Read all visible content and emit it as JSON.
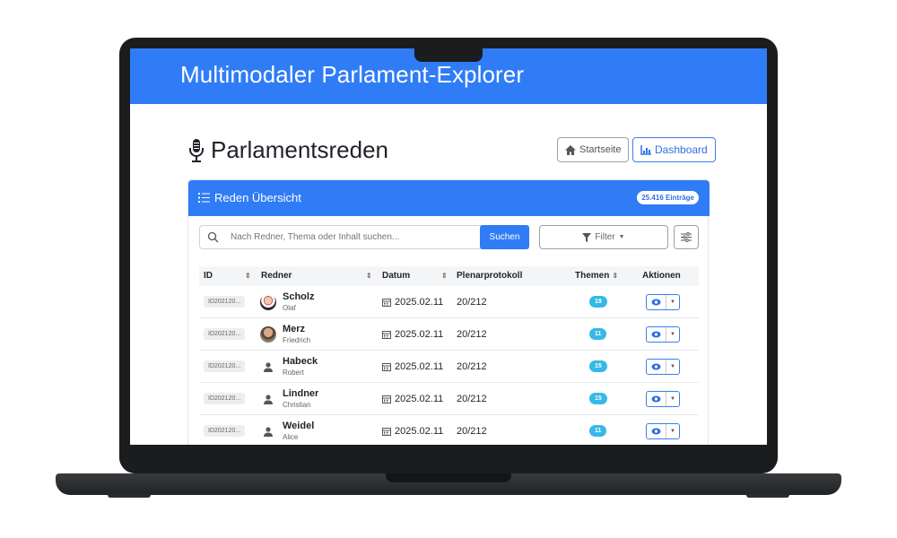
{
  "app": {
    "title": "Multimodaler Parlament-Explorer"
  },
  "page": {
    "title": "Parlamentsreden"
  },
  "nav": {
    "home_label": "Startseite",
    "dashboard_label": "Dashboard"
  },
  "card": {
    "title": "Reden Übersicht",
    "count": "25.416 Einträge"
  },
  "search": {
    "placeholder": "Nach Redner, Thema oder Inhalt suchen...",
    "button_label": "Suchen"
  },
  "filter": {
    "label": "Filter"
  },
  "table": {
    "headers": {
      "id": "ID",
      "speaker": "Redner",
      "date": "Datum",
      "protocol": "Plenarprotokoll",
      "topics": "Themen",
      "actions": "Aktionen"
    },
    "rows": [
      {
        "id": "ID202120...",
        "last": "Scholz",
        "first": "Olaf",
        "date": "2025.02.11",
        "protocol": "20/212",
        "topics": "19",
        "avatar": "photo-1"
      },
      {
        "id": "ID202120...",
        "last": "Merz",
        "first": "Friedrich",
        "date": "2025.02.11",
        "protocol": "20/212",
        "topics": "11",
        "avatar": "photo-2"
      },
      {
        "id": "ID202120...",
        "last": "Habeck",
        "first": "Robert",
        "date": "2025.02.11",
        "protocol": "20/212",
        "topics": "15",
        "avatar": "generic"
      },
      {
        "id": "ID202120...",
        "last": "Lindner",
        "first": "Christian",
        "date": "2025.02.11",
        "protocol": "20/212",
        "topics": "15",
        "avatar": "generic"
      },
      {
        "id": "ID202120...",
        "last": "Weidel",
        "first": "Alice",
        "date": "2025.02.11",
        "protocol": "20/212",
        "topics": "11",
        "avatar": "generic"
      }
    ]
  },
  "colors": {
    "primary": "#2f7cf6",
    "info": "#36b9e6"
  },
  "icons": {
    "mic": "microphone-icon",
    "home": "home-icon",
    "dashboard": "chart-icon",
    "list": "list-icon",
    "search": "search-icon",
    "filter": "filter-icon",
    "settings": "sliders-icon",
    "calendar": "calendar-icon",
    "view": "eye-icon"
  }
}
